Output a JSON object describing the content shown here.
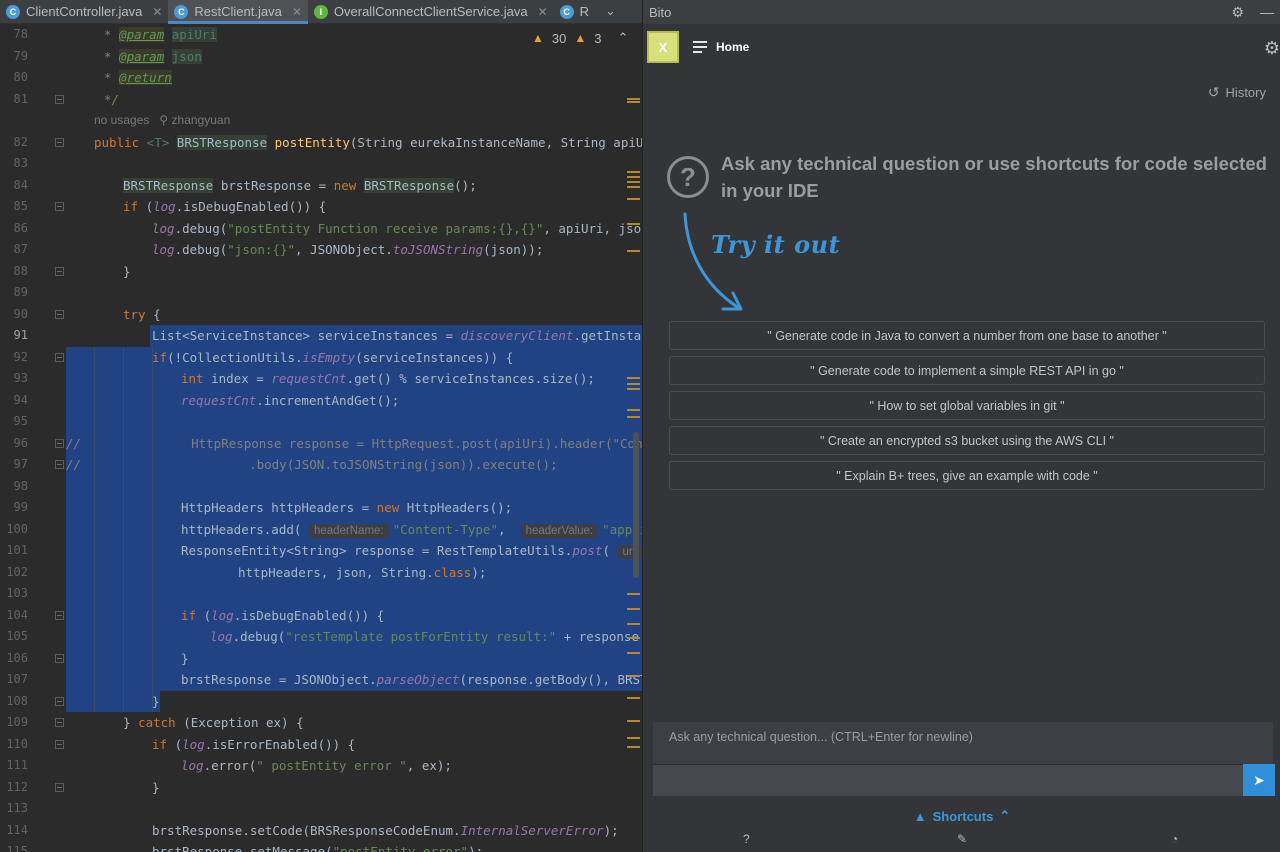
{
  "editor": {
    "tabs": [
      {
        "label": "ClientController.java",
        "badge": "C",
        "active": false
      },
      {
        "label": "RestClient.java",
        "badge": "C",
        "active": true
      },
      {
        "label": "OverallConnectClientService.java",
        "badge": "I",
        "active": false
      },
      {
        "label": "R",
        "badge": "C",
        "active": false
      }
    ],
    "inspections": {
      "warnings": "30",
      "weak_warnings": "3"
    },
    "usage_hint": {
      "usages": "no usages",
      "author": "zhangyuan"
    },
    "hints": {
      "header_name": "headerName:",
      "header_value": "headerValue:",
      "url": "url:"
    },
    "line_numbers": [
      "78",
      "79",
      "80",
      "81",
      "82",
      "83",
      "84",
      "85",
      "86",
      "87",
      "88",
      "89",
      "90",
      "91",
      "92",
      "93",
      "94",
      "95",
      "96",
      "97",
      "98",
      "99",
      "100",
      "101",
      "102",
      "103",
      "104",
      "105",
      "106",
      "107",
      "108",
      "109",
      "110",
      "111",
      "112",
      "113",
      "114",
      "115"
    ],
    "code": {
      "l78": [
        "* ",
        "@param",
        " ",
        "apiUri"
      ],
      "l79": [
        "* ",
        "@param",
        " ",
        "json"
      ],
      "l80": [
        "* ",
        "@return"
      ],
      "l81": "*/",
      "l82": [
        "public ",
        "<T> ",
        "BRSTResponse",
        " ",
        "postEntity",
        "(String eurekaInstanceName, String apiUri,"
      ],
      "l84": [
        "BRSTResponse",
        " ",
        "brstResponse",
        " = ",
        "new ",
        "BRSTResponse",
        "();"
      ],
      "l85": [
        "if ",
        "(",
        "log",
        ".isDebugEnabled()) {"
      ],
      "l86": [
        "log",
        ".debug(",
        "\"postEntity Function receive params:{},{}\"",
        ", apiUri, json);"
      ],
      "l87": [
        "log",
        ".debug(",
        "\"json:{}\"",
        ", JSONObject.",
        "toJSONString",
        "(json));"
      ],
      "l88": "}",
      "l90": [
        "try",
        " {"
      ],
      "l91": [
        "List<ServiceInstance> serviceInstances = ",
        "discoveryClient",
        ".getInstances("
      ],
      "l92": [
        "if",
        "(!CollectionUtils.",
        "isEmpty",
        "(serviceInstances)) {"
      ],
      "l93": [
        "int ",
        "index = ",
        "requestCnt",
        ".get() % serviceInstances.size();"
      ],
      "l94": [
        "requestCnt",
        ".incrementAndGet();"
      ],
      "l96": [
        "//",
        "HttpResponse response = HttpRequest.post(apiUri).header(\"Conten"
      ],
      "l97": [
        "//",
        ".body(JSON.toJSONString(json)).execute();"
      ],
      "l99": [
        "HttpHeaders httpHeaders = ",
        "new ",
        "HttpHeaders();"
      ],
      "l100": [
        "httpHeaders.add( ",
        "\"Content-Type\"",
        ",  ",
        "\"applicat"
      ],
      "l101": [
        "ResponseEntity<String> response = RestTemplateUtils.",
        "post",
        "( ",
        "ser"
      ],
      "l102": [
        "httpHeaders, json, String.",
        "class",
        ");"
      ],
      "l104": [
        "if ",
        "(",
        "log",
        ".isDebugEnabled()) {"
      ],
      "l105": [
        "log",
        ".debug(",
        "\"restTemplate postForEntity result:\"",
        " + response.ge"
      ],
      "l106": "}",
      "l107": [
        "brstResponse",
        " = JSONObject.",
        "parseObject",
        "(response.getBody(), BRSTRes"
      ],
      "l108": "}",
      "l109": [
        "} ",
        "catch ",
        "(Exception ex) {"
      ],
      "l110": [
        "if ",
        "(",
        "log",
        ".isErrorEnabled()) {"
      ],
      "l111": [
        "log",
        ".error(",
        "\" postEntity error \"",
        ", ex);"
      ],
      "l112": "}",
      "l114": [
        "brstResponse",
        ".setCode(BRSResponseCodeEnum.",
        "InternalServerError",
        ");"
      ],
      "l115": [
        "brstResponse",
        ".setMessage(",
        "\"postEntity error\"",
        ");"
      ]
    }
  },
  "bito": {
    "panel_title": "Bito",
    "avatar_letter": "X",
    "home_label": "Home",
    "history_label": "History",
    "headline": "Ask any technical question or use shortcuts for code selected in your IDE",
    "try_it_out": "Try it out",
    "prompts": [
      "\" Generate code in Java to convert a number from one base to another \"",
      "\" Generate code to implement a simple REST API in go \"",
      "\" How to set global variables in git \"",
      "\" Create an encrypted s3 bucket using the AWS CLI \"",
      "\" Explain B+ trees, give an example with code \""
    ],
    "chat_placeholder": "Ask any technical question... (CTRL+Enter for newline)",
    "shortcuts_label": "Shortcuts"
  },
  "colors": {
    "accent": "#3b97d8",
    "selection": "#214283",
    "keyword": "#cc7832",
    "string": "#6a8759"
  }
}
